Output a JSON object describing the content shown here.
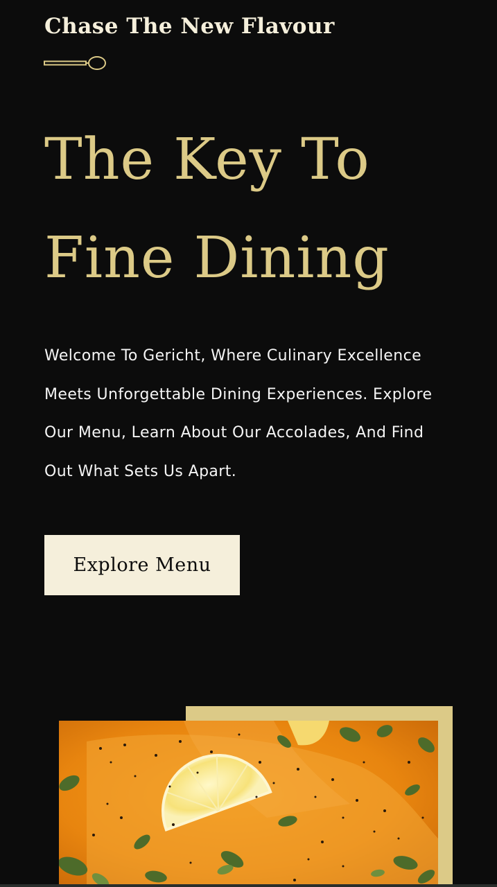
{
  "hero": {
    "subtitle": "Chase The New Flavour",
    "headline_line1": "The Key To",
    "headline_line2": "Fine Dining",
    "intro_line1": "Welcome To Gericht, Where Culinary Excellence",
    "intro_line2": "Meets Unforgettable Dining Experiences. Explore",
    "intro_line3": "Our Menu, Learn About Our Accolades, And Find",
    "intro_line4": "Out What Sets Us Apart.",
    "explore_label": "Explore Menu"
  },
  "icons": {
    "divider": "spoon-icon"
  },
  "colors": {
    "background": "#0c0c0c",
    "gold": "#dcca87",
    "cream": "#f5efdb",
    "text_white": "#f5f5f5"
  }
}
